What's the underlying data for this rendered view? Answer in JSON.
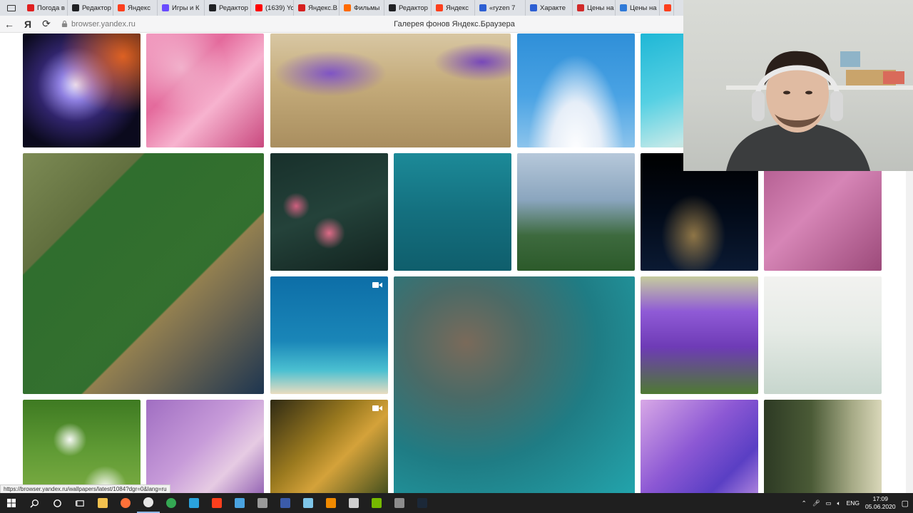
{
  "tabs": [
    {
      "label": "Погода в",
      "icon": "weather-icon",
      "color": "#e02020"
    },
    {
      "label": "Редактор",
      "icon": "editor-plus-icon",
      "color": "#202124"
    },
    {
      "label": "Яндекс",
      "icon": "yandex-icon",
      "color": "#fc3f1d"
    },
    {
      "label": "Игры и К",
      "icon": "games-icon",
      "color": "#6a4cff"
    },
    {
      "label": "Редактор",
      "icon": "editor-plus-icon",
      "color": "#202124"
    },
    {
      "label": "(1639) Yo",
      "icon": "youtube-icon",
      "color": "#ff0000"
    },
    {
      "label": "Яндекс.В",
      "icon": "yandex-doc-icon",
      "color": "#d62020"
    },
    {
      "label": "Фильмы",
      "icon": "films-icon",
      "color": "#ff6a00"
    },
    {
      "label": "Редактор",
      "icon": "editor-plus-icon",
      "color": "#202124"
    },
    {
      "label": "Яндекс",
      "icon": "yandex-icon",
      "color": "#fc3f1d"
    },
    {
      "label": "«ryzen 7",
      "icon": "market-icon",
      "color": "#2d5fd3"
    },
    {
      "label": "Характе",
      "icon": "market-icon",
      "color": "#2d5fd3"
    },
    {
      "label": "Цены на",
      "icon": "price-icon",
      "color": "#d12a2a"
    },
    {
      "label": "Цены на",
      "icon": "price-s-icon",
      "color": "#2f7ad8"
    },
    {
      "label": "Я",
      "icon": "yandex-icon",
      "color": "#fc3f1d"
    }
  ],
  "addressbar": {
    "back": "←",
    "yandex": "Я",
    "reload": "⟳",
    "url": "browser.yandex.ru",
    "title": "Галерея фонов Яндекс.Браузера"
  },
  "gallery": {
    "tiles": [
      {
        "name": "space-nebula",
        "bg": "radial-gradient(ellipse at 45% 45%, #e9e6ff 0%, #8e7fe0 18%, #30246b 42%, #0b0a1d 75%), #0b0a1d",
        "accent": "radial-gradient(ellipse at 85% 20%, rgba(255,110,30,0.85) 0%, rgba(255,90,20,0) 45%)"
      },
      {
        "name": "pink-blossom",
        "bg": "linear-gradient(135deg, #f29bc0 0%, #e46a9c 35%, #f7b3cf 60%, #c9487e 100%)",
        "accent": "radial-gradient(circle at 30% 30%, rgba(255,255,255,0.45) 0%, rgba(255,255,255,0) 40%)"
      },
      {
        "name": "purple-crocus-grass",
        "bg": "linear-gradient(180deg, #d8c7a3 0%, #c4ab7a 45%, #a98e5f 100%)",
        "accent": "radial-gradient(ellipse at 25% 35%, rgba(123,79,200,0.95) 0%, rgba(123,79,200,0) 22%), radial-gradient(ellipse at 88% 25%, rgba(110,60,190,0.9) 0%, rgba(110,60,190,0) 16%)"
      },
      {
        "name": "mount-fuji",
        "bg": "linear-gradient(180deg, #2f8fd8 0%, #4aa3e4 55%, #8cc4ec 100%)",
        "accent": "radial-gradient(ellipse at 50% 105%, #ffffff 0%, #e6eef8 30%, rgba(255,255,255,0) 58%)"
      },
      {
        "name": "turquoise-sea-strip",
        "bg": "linear-gradient(160deg, #1fb7d6 0%, #55d0e3 45%, #bfe8e8 78%, #e8dcc0 100%)",
        "accent": ""
      },
      {
        "name": "football-field-aerial",
        "bg": "linear-gradient(135deg, #7d8b55 0%, #5c6a3a 30%, #a98f4f 55%, #6f6750 75%, #1d3550 100%)",
        "accent": "linear-gradient(135deg, rgba(0,0,0,0) 25%, rgba(45,110,45,0.95) 25.5%, rgba(45,110,45,0.95) 62%, rgba(0,0,0,0) 62.5%)"
      },
      {
        "name": "camellia-flowers",
        "bg": "linear-gradient(160deg, #18302b 0%, #24423a 50%, #12231f 100%)",
        "accent": "radial-gradient(circle at 50% 68%, rgba(232,110,140,0.95) 0%, rgba(232,110,140,0) 16%), radial-gradient(circle at 22% 45%, rgba(225,100,135,0.9) 0%, rgba(225,100,135,0) 12%)"
      },
      {
        "name": "boats-on-teal-water",
        "bg": "linear-gradient(180deg, #1c8a98 0%, #14707f 50%, #0f5e6c 100%)",
        "accent": ""
      },
      {
        "name": "misty-forest",
        "bg": "linear-gradient(180deg, #b6c8da 0%, #8aa5be 40%, #3d6a3e 70%, #2c5a2a 100%)",
        "accent": ""
      },
      {
        "name": "earth-night-lights",
        "bg": "linear-gradient(180deg, #000000 0%, #020a18 50%, #0b1a33 100%)",
        "accent": "radial-gradient(ellipse at 45% 70%, rgba(255,200,100,0.55) 0%, rgba(255,200,100,0) 35%)"
      },
      {
        "name": "pink-tree-branches",
        "bg": "linear-gradient(135deg, #b05a8d 0%, #d685b6 45%, #9c4a7a 100%)",
        "accent": ""
      },
      {
        "name": "blue-beach-aerial",
        "bg": "linear-gradient(180deg, #0d6ea7 0%, #1a86b8 55%, #4bc0d1 80%, #e9dcc0 100%)",
        "accent": ""
      },
      {
        "name": "teal-rocks-aerial",
        "bg": "radial-gradient(ellipse at 30% 30%, #7a6a5a 0%, #4b6a66 25%, #1f7c84 55%, #23a5ad 100%)",
        "accent": ""
      },
      {
        "name": "purple-crocus-closeup",
        "bg": "linear-gradient(180deg, #c6cc9e 0%, #8f5ad6 30%, #6e3bb6 60%, #4e7a32 100%)",
        "accent": ""
      },
      {
        "name": "white-flower-meadow",
        "bg": "linear-gradient(180deg, #f2f2f0 0%, #e6ebe6 45%, #c7d6cd 100%)",
        "accent": ""
      },
      {
        "name": "daisies",
        "bg": "linear-gradient(180deg, #3e7a22 0%, #5f9a34 50%, #7fae45 100%)",
        "accent": "radial-gradient(circle at 40% 40%, rgba(255,255,255,0.95) 0%, rgba(255,255,255,0) 18%), radial-gradient(circle at 70% 88%, rgba(255,255,255,0.95) 0%, rgba(255,255,255,0) 18%)"
      },
      {
        "name": "lavender-bokeh",
        "bg": "linear-gradient(135deg, #a06ec2 0%, #c79bd9 45%, #e6cbe3 70%, #8e5cb0 100%)",
        "accent": ""
      },
      {
        "name": "golden-leaves",
        "bg": "linear-gradient(135deg, #2f2a14 0%, #9b7a1f 40%, #d4a23a 60%, #3b4a1c 100%)",
        "accent": ""
      },
      {
        "name": "purple-hydrangea",
        "bg": "linear-gradient(135deg, #d8a8e6 0%, #8c58d4 45%, #5a3fc4 75%, #b58ae0 100%)",
        "accent": ""
      },
      {
        "name": "forest-sunlight",
        "bg": "linear-gradient(90deg, #2d3a24 0%, #4a5a36 40%, #a6aa86 75%, #d9d7b9 100%)",
        "accent": ""
      }
    ]
  },
  "status_link": "https://browser.yandex.ru/wallpapers/latest/1084?dgr=0&lang=ru",
  "taskbar": {
    "apps": [
      {
        "icon": "file-explorer-icon",
        "color": "#f2c14e"
      },
      {
        "icon": "firefox-icon",
        "color": "#ff7139"
      },
      {
        "icon": "yandex-browser-icon",
        "color": "#e6e6e6"
      },
      {
        "icon": "chrome-icon",
        "color": "#34a853"
      },
      {
        "icon": "telegram-icon",
        "color": "#2aa3dd"
      },
      {
        "icon": "yandex-icon",
        "color": "#fc3f1d"
      },
      {
        "icon": "network-icon",
        "color": "#4aa3e0"
      },
      {
        "icon": "app-icon",
        "color": "#9a9a9a"
      },
      {
        "icon": "notes-icon",
        "color": "#3b5ba9"
      },
      {
        "icon": "paper-icon",
        "color": "#7ec5e8"
      },
      {
        "icon": "vlc-icon",
        "color": "#f08a00"
      },
      {
        "icon": "calculator-icon",
        "color": "#cfcfcf"
      },
      {
        "icon": "nvidia-icon",
        "color": "#76b900"
      },
      {
        "icon": "camera-icon",
        "color": "#8c8c8c"
      },
      {
        "icon": "steam-icon",
        "color": "#1b2838"
      }
    ],
    "language": "ENG",
    "time": "17:09",
    "date": "05.06.2020"
  }
}
